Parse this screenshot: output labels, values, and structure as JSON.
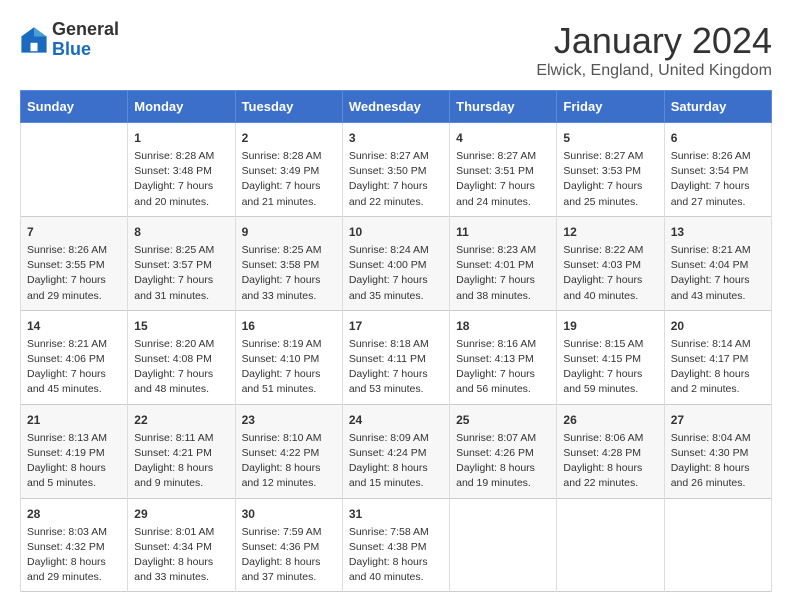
{
  "header": {
    "logo_line1": "General",
    "logo_line2": "Blue",
    "month": "January 2024",
    "location": "Elwick, England, United Kingdom"
  },
  "weekdays": [
    "Sunday",
    "Monday",
    "Tuesday",
    "Wednesday",
    "Thursday",
    "Friday",
    "Saturday"
  ],
  "weeks": [
    [
      {
        "day": "",
        "info": ""
      },
      {
        "day": "1",
        "info": "Sunrise: 8:28 AM\nSunset: 3:48 PM\nDaylight: 7 hours\nand 20 minutes."
      },
      {
        "day": "2",
        "info": "Sunrise: 8:28 AM\nSunset: 3:49 PM\nDaylight: 7 hours\nand 21 minutes."
      },
      {
        "day": "3",
        "info": "Sunrise: 8:27 AM\nSunset: 3:50 PM\nDaylight: 7 hours\nand 22 minutes."
      },
      {
        "day": "4",
        "info": "Sunrise: 8:27 AM\nSunset: 3:51 PM\nDaylight: 7 hours\nand 24 minutes."
      },
      {
        "day": "5",
        "info": "Sunrise: 8:27 AM\nSunset: 3:53 PM\nDaylight: 7 hours\nand 25 minutes."
      },
      {
        "day": "6",
        "info": "Sunrise: 8:26 AM\nSunset: 3:54 PM\nDaylight: 7 hours\nand 27 minutes."
      }
    ],
    [
      {
        "day": "7",
        "info": "Sunrise: 8:26 AM\nSunset: 3:55 PM\nDaylight: 7 hours\nand 29 minutes."
      },
      {
        "day": "8",
        "info": "Sunrise: 8:25 AM\nSunset: 3:57 PM\nDaylight: 7 hours\nand 31 minutes."
      },
      {
        "day": "9",
        "info": "Sunrise: 8:25 AM\nSunset: 3:58 PM\nDaylight: 7 hours\nand 33 minutes."
      },
      {
        "day": "10",
        "info": "Sunrise: 8:24 AM\nSunset: 4:00 PM\nDaylight: 7 hours\nand 35 minutes."
      },
      {
        "day": "11",
        "info": "Sunrise: 8:23 AM\nSunset: 4:01 PM\nDaylight: 7 hours\nand 38 minutes."
      },
      {
        "day": "12",
        "info": "Sunrise: 8:22 AM\nSunset: 4:03 PM\nDaylight: 7 hours\nand 40 minutes."
      },
      {
        "day": "13",
        "info": "Sunrise: 8:21 AM\nSunset: 4:04 PM\nDaylight: 7 hours\nand 43 minutes."
      }
    ],
    [
      {
        "day": "14",
        "info": "Sunrise: 8:21 AM\nSunset: 4:06 PM\nDaylight: 7 hours\nand 45 minutes."
      },
      {
        "day": "15",
        "info": "Sunrise: 8:20 AM\nSunset: 4:08 PM\nDaylight: 7 hours\nand 48 minutes."
      },
      {
        "day": "16",
        "info": "Sunrise: 8:19 AM\nSunset: 4:10 PM\nDaylight: 7 hours\nand 51 minutes."
      },
      {
        "day": "17",
        "info": "Sunrise: 8:18 AM\nSunset: 4:11 PM\nDaylight: 7 hours\nand 53 minutes."
      },
      {
        "day": "18",
        "info": "Sunrise: 8:16 AM\nSunset: 4:13 PM\nDaylight: 7 hours\nand 56 minutes."
      },
      {
        "day": "19",
        "info": "Sunrise: 8:15 AM\nSunset: 4:15 PM\nDaylight: 7 hours\nand 59 minutes."
      },
      {
        "day": "20",
        "info": "Sunrise: 8:14 AM\nSunset: 4:17 PM\nDaylight: 8 hours\nand 2 minutes."
      }
    ],
    [
      {
        "day": "21",
        "info": "Sunrise: 8:13 AM\nSunset: 4:19 PM\nDaylight: 8 hours\nand 5 minutes."
      },
      {
        "day": "22",
        "info": "Sunrise: 8:11 AM\nSunset: 4:21 PM\nDaylight: 8 hours\nand 9 minutes."
      },
      {
        "day": "23",
        "info": "Sunrise: 8:10 AM\nSunset: 4:22 PM\nDaylight: 8 hours\nand 12 minutes."
      },
      {
        "day": "24",
        "info": "Sunrise: 8:09 AM\nSunset: 4:24 PM\nDaylight: 8 hours\nand 15 minutes."
      },
      {
        "day": "25",
        "info": "Sunrise: 8:07 AM\nSunset: 4:26 PM\nDaylight: 8 hours\nand 19 minutes."
      },
      {
        "day": "26",
        "info": "Sunrise: 8:06 AM\nSunset: 4:28 PM\nDaylight: 8 hours\nand 22 minutes."
      },
      {
        "day": "27",
        "info": "Sunrise: 8:04 AM\nSunset: 4:30 PM\nDaylight: 8 hours\nand 26 minutes."
      }
    ],
    [
      {
        "day": "28",
        "info": "Sunrise: 8:03 AM\nSunset: 4:32 PM\nDaylight: 8 hours\nand 29 minutes."
      },
      {
        "day": "29",
        "info": "Sunrise: 8:01 AM\nSunset: 4:34 PM\nDaylight: 8 hours\nand 33 minutes."
      },
      {
        "day": "30",
        "info": "Sunrise: 7:59 AM\nSunset: 4:36 PM\nDaylight: 8 hours\nand 37 minutes."
      },
      {
        "day": "31",
        "info": "Sunrise: 7:58 AM\nSunset: 4:38 PM\nDaylight: 8 hours\nand 40 minutes."
      },
      {
        "day": "",
        "info": ""
      },
      {
        "day": "",
        "info": ""
      },
      {
        "day": "",
        "info": ""
      }
    ]
  ]
}
